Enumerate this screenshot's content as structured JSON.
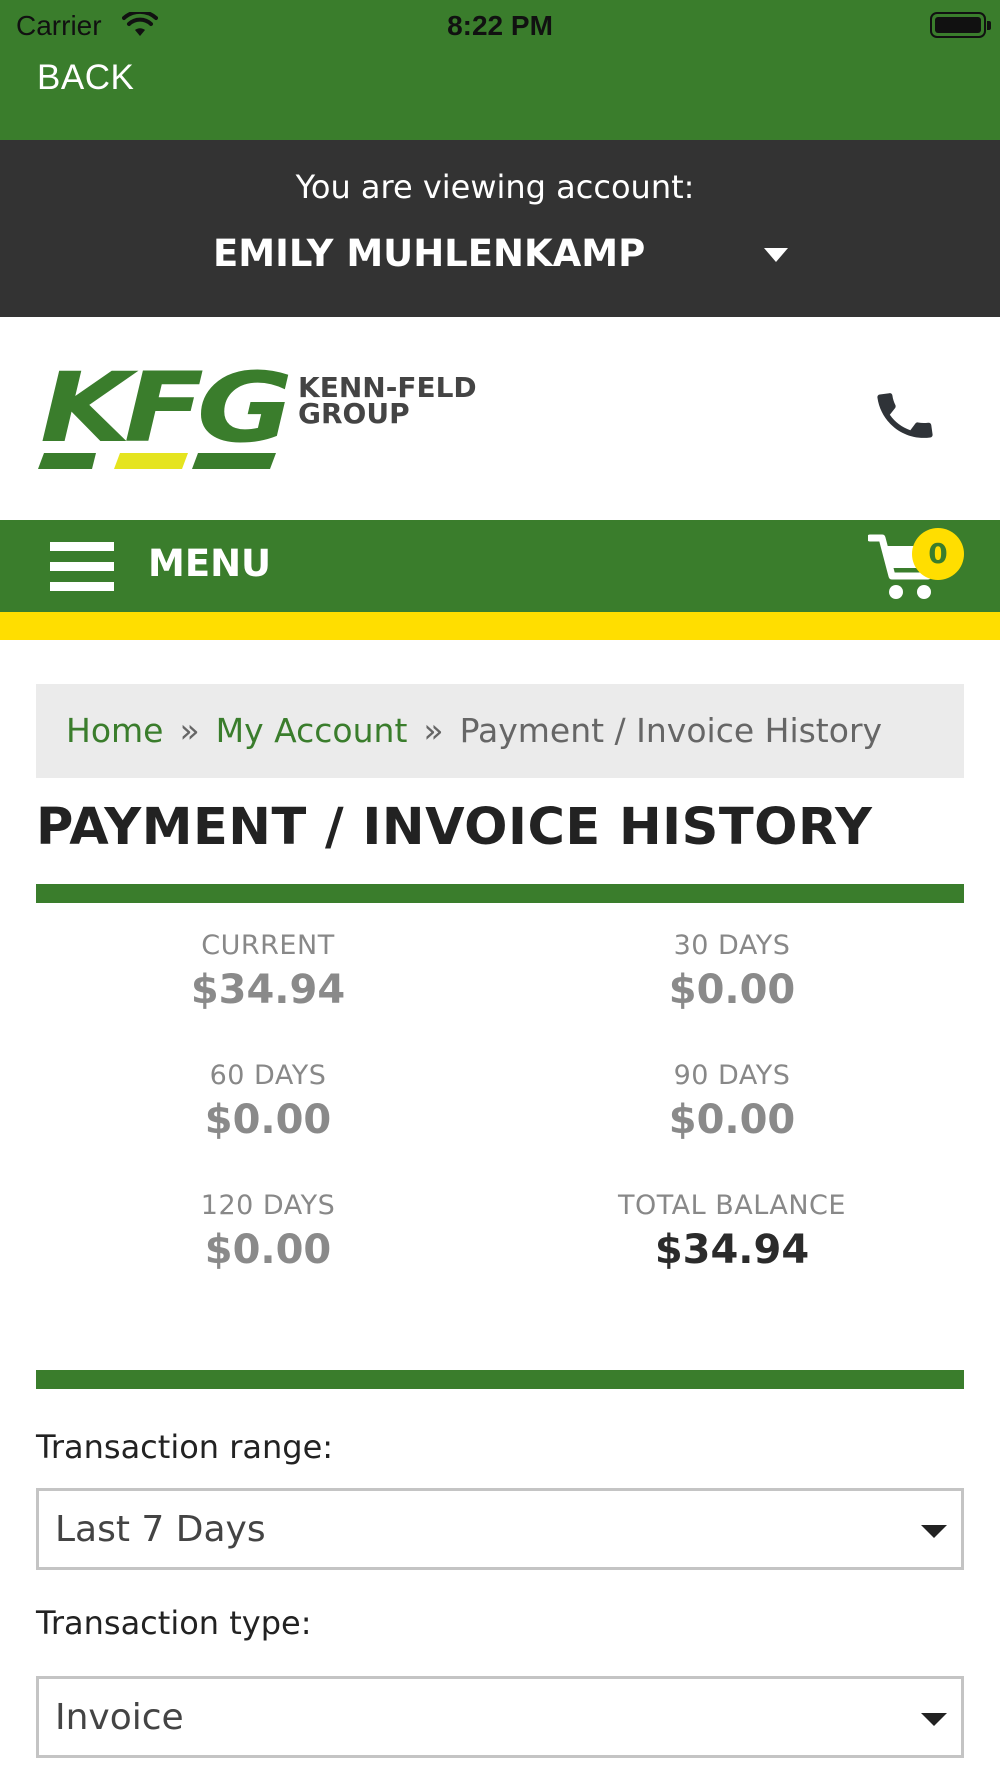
{
  "status_bar": {
    "carrier": "Carrier",
    "time": "8:22 PM"
  },
  "nav": {
    "back_label": "BACK"
  },
  "account": {
    "caption": "You are viewing account:",
    "name": "EMILY MUHLENKAMP"
  },
  "brand": {
    "logo_letters": "KFG",
    "logo_line1": "KENN-FELD",
    "logo_line2": "GROUP",
    "green": "#3a7d2c",
    "yellow": "#ffde00",
    "dark": "#333333"
  },
  "menu": {
    "label": "MENU",
    "cart_count": "0"
  },
  "breadcrumb": {
    "home": "Home",
    "sep": "»",
    "account": "My Account",
    "current": "Payment / Invoice History"
  },
  "page": {
    "title": "PAYMENT / INVOICE HISTORY"
  },
  "aging": [
    {
      "label": "CURRENT",
      "value": "$34.94"
    },
    {
      "label": "30 DAYS",
      "value": "$0.00"
    },
    {
      "label": "60 DAYS",
      "value": "$0.00"
    },
    {
      "label": "90 DAYS",
      "value": "$0.00"
    },
    {
      "label": "120 DAYS",
      "value": "$0.00"
    },
    {
      "label": "TOTAL BALANCE",
      "value": "$34.94"
    }
  ],
  "filters": {
    "range_label": "Transaction range:",
    "range_value": "Last 7 Days",
    "type_label": "Transaction type:",
    "type_value": "Invoice"
  },
  "icons": {
    "wifi": "wifi-icon",
    "battery": "battery-icon",
    "phone": "phone-icon",
    "menu": "hamburger-icon",
    "cart": "cart-icon",
    "caret": "caret-down-icon"
  }
}
